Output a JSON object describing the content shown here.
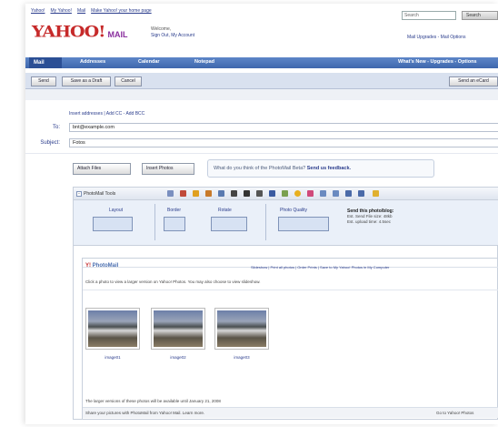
{
  "top_links": [
    "Yahoo!",
    "My Yahoo!",
    "Mail",
    "Make Yahoo! your home page"
  ],
  "search": {
    "placeholder": "Search",
    "button_label": "Search"
  },
  "logo": {
    "brand": "YAHOO!",
    "product": "MAIL"
  },
  "welcome": {
    "line1": "Welcome,",
    "line2": "Sign Out, My Account"
  },
  "header_links": "Mail Upgrades - Mail Options",
  "tabs": {
    "mail": "Mail",
    "addresses": "Addresses",
    "calendar": "Calendar",
    "notepad": "Notepad",
    "right": "What's New - Upgrades - Options"
  },
  "actions": {
    "send": "Send",
    "save_draft": "Save as a Draft",
    "cancel": "Cancel",
    "right": "Send an eCard"
  },
  "compose": {
    "address_links": "Insert addresses | Add CC - Add BCC",
    "to_label": "To:",
    "to_value": "bnt@example.com",
    "subject_label": "Subject:",
    "subject_value": "Fotos"
  },
  "controls": {
    "attach": "Attach Files",
    "insert_photos": "Insert Photos",
    "feedback_text": "What do you think of the PhotoMail Beta?",
    "feedback_link": "Send us feedback."
  },
  "photomail": {
    "tools_label": "PhotoMail Tools",
    "options": {
      "layout": "Layout",
      "border": "Border",
      "rotate": "Rotate",
      "photo_quality": "Photo Quality"
    },
    "send_info_title": "Send this photo/blog:",
    "send_info_l1": "Est. Send File size: 48kb",
    "send_info_l2": "Est. upload time: 4.5sec",
    "header_logo_y": "Y!",
    "header_logo_text": "PhotoMail",
    "header_links": "Slideshow | Print all photos | Order Prints | Save to My Yahoo! Photos in My Computer",
    "description": "Click a photo to view a larger version on Yahoo! Photos. You may also choose to view slideshow.",
    "photos": [
      {
        "caption": "image01"
      },
      {
        "caption": "image02"
      },
      {
        "caption": "image03"
      }
    ],
    "note": "The larger versions of these photos will be available until January 21, 2008",
    "footer_left": "Share your pictures with PhotoMail from Yahoo! Mail. Learn more.",
    "footer_right": "Go to Yahoo! Photos"
  }
}
